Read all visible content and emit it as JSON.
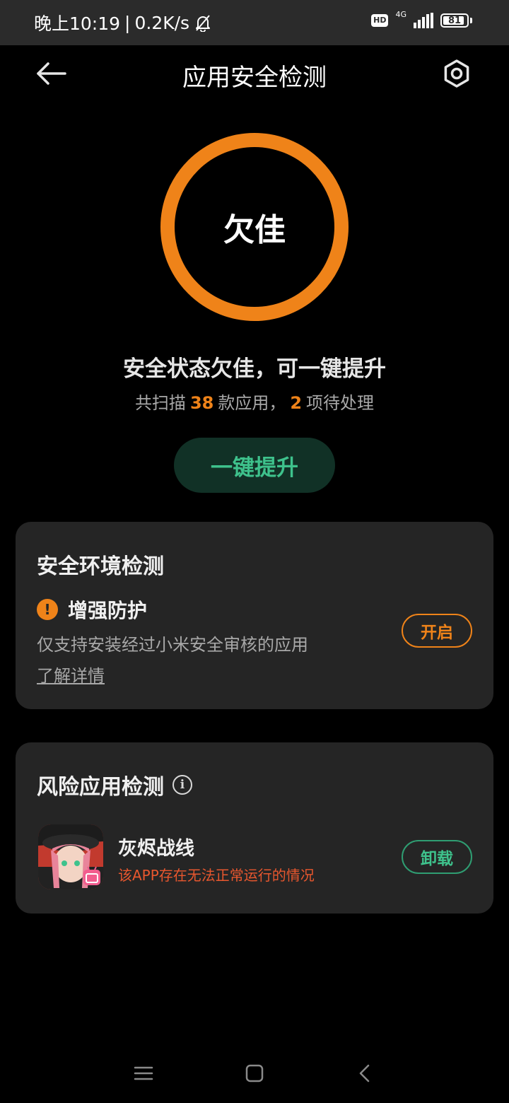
{
  "status_bar": {
    "time": "晚上10:19",
    "separator": "|",
    "net_speed": "0.2K/s",
    "hd": "HD",
    "network_type": "4G",
    "battery": "81"
  },
  "header": {
    "title": "应用安全检测",
    "back_icon": "arrow-left-icon",
    "settings_icon": "gear-icon"
  },
  "status_ring": {
    "label": "欠佳",
    "color": "#ef8319"
  },
  "summary": {
    "title": "安全状态欠佳，可一键提升",
    "prefix": "共扫描",
    "scanned_count": "38",
    "middle": "款应用，",
    "pending_count": "2",
    "suffix": "项待处理"
  },
  "boost_button": {
    "label": "一键提升"
  },
  "env_card": {
    "title": "安全环境检测",
    "item": {
      "title": "增强防护",
      "description": "仅支持安装经过小米安全审核的应用",
      "link": "了解详情",
      "button": "开启",
      "warning_glyph": "!"
    }
  },
  "risk_card": {
    "title": "风险应用检测",
    "info_glyph": "i",
    "app": {
      "name": "灰烬战线",
      "warning": "该APP存在无法正常运行的情况",
      "button": "卸载"
    }
  },
  "colors": {
    "accent_orange": "#ef8319",
    "accent_green": "#3ec28c",
    "warning_red": "#e8572e",
    "card_bg": "#252525"
  },
  "nav_bar": {
    "menu_icon": "menu-icon",
    "home_icon": "home-square-icon",
    "back_icon": "chevron-left-icon"
  }
}
